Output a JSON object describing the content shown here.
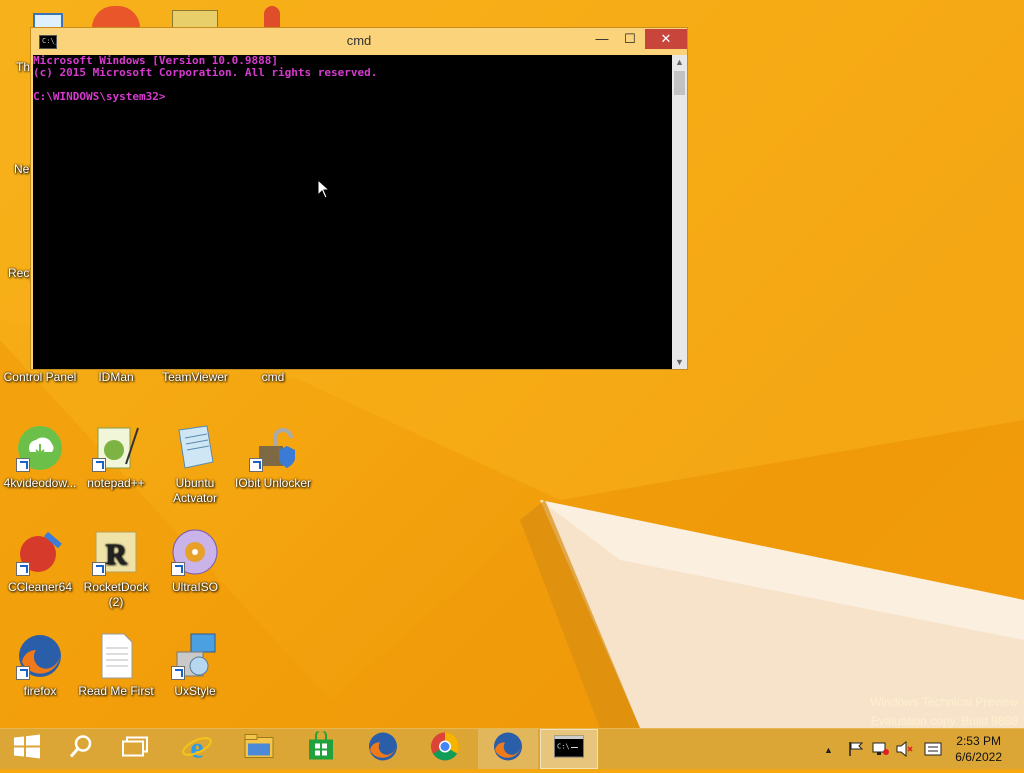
{
  "desktop": {
    "icons": [
      {
        "name": "this-pc",
        "label": "This PC"
      },
      {
        "name": "network",
        "label": "Network"
      },
      {
        "name": "recycle-bin",
        "label": "Recycle Bin"
      },
      {
        "name": "control-panel",
        "label": "Control Panel"
      },
      {
        "name": "idman",
        "label": "IDMan"
      },
      {
        "name": "teamviewer",
        "label": "TeamViewer"
      },
      {
        "name": "cmd",
        "label": "cmd"
      },
      {
        "name": "4kvideodownloader",
        "label": "4kvideodow..."
      },
      {
        "name": "notepadpp",
        "label": "notepad++"
      },
      {
        "name": "ubuntu-activator",
        "label": "Ubuntu Actvator"
      },
      {
        "name": "iobit-unlocker",
        "label": "IObit Unlocker"
      },
      {
        "name": "ccleaner",
        "label": "CCleaner64"
      },
      {
        "name": "rocketdock",
        "label": "RocketDock (2)"
      },
      {
        "name": "ultraiso",
        "label": "UltraISO"
      },
      {
        "name": "firefox",
        "label": "firefox"
      },
      {
        "name": "readme",
        "label": "Read Me First"
      },
      {
        "name": "uxstyle",
        "label": "UxStyle"
      }
    ]
  },
  "cmd_window": {
    "title": "cmd",
    "icon_text": "C:\\_",
    "lines": [
      "Microsoft Windows [Version 10.0.9888]",
      "(c) 2015 Microsoft Corporation. All rights reserved.",
      "",
      "C:\\WINDOWS\\system32>"
    ],
    "text_color": "#d83ad0"
  },
  "watermark": {
    "line1": "Windows Technical Preview",
    "line2": "Evaluation copy. Build 9888"
  },
  "taskbar": {
    "items": [
      "start-icon",
      "search-icon",
      "task-view-icon",
      "internet-explorer-icon",
      "file-explorer-icon",
      "store-icon",
      "firefox-icon",
      "chrome-icon",
      "firefox-icon",
      "cmd-icon"
    ],
    "active_item": "cmd-icon",
    "clock_time": "2:53 PM",
    "clock_date": "6/6/2022"
  },
  "colors": {
    "wallpaper": "#f5a70f",
    "taskbar": "#dca637",
    "close_button": "#c7453a"
  }
}
